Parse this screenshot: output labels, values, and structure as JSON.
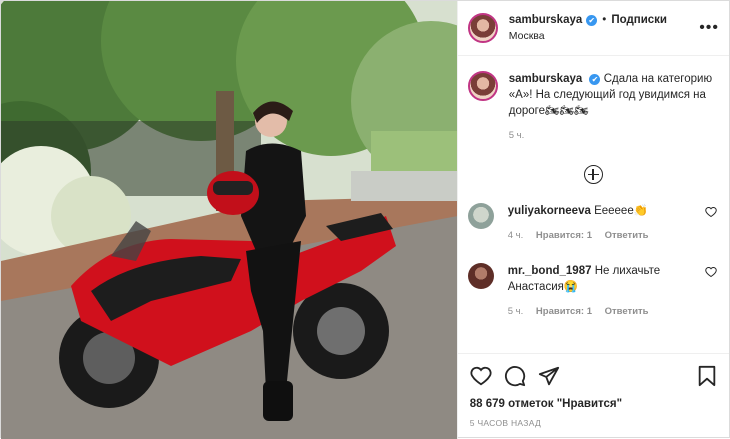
{
  "header": {
    "username": "samburskaya",
    "verified_mark": "✔",
    "separator": "•",
    "follow_label": "Подписки",
    "location": "Москва",
    "more_icon": "•••"
  },
  "caption": {
    "username": "samburskaya",
    "text": "Сдала на категорию «А»! На следующий год увидимся на дороге🏍🏍🏍",
    "age": "5 ч."
  },
  "comments": [
    {
      "username": "yuliyakorneeva",
      "text": "Ееееее👏",
      "age": "4 ч.",
      "likes": "Нравится: 1",
      "reply": "Ответить"
    },
    {
      "username": "mr._bond_1987",
      "text": "Не лихачьте Анастасия😭",
      "age": "5 ч.",
      "likes": "Нравится: 1",
      "reply": "Ответить"
    }
  ],
  "actions": {
    "likes_text": "88 679 отметок \"Нравится\"",
    "posted_time": "5 ЧАСОВ НАЗАД"
  },
  "colors": {
    "verified": "#3897f0",
    "text": "#262626",
    "muted": "#8e8e8e",
    "motorcycle_red": "#d0101c"
  }
}
